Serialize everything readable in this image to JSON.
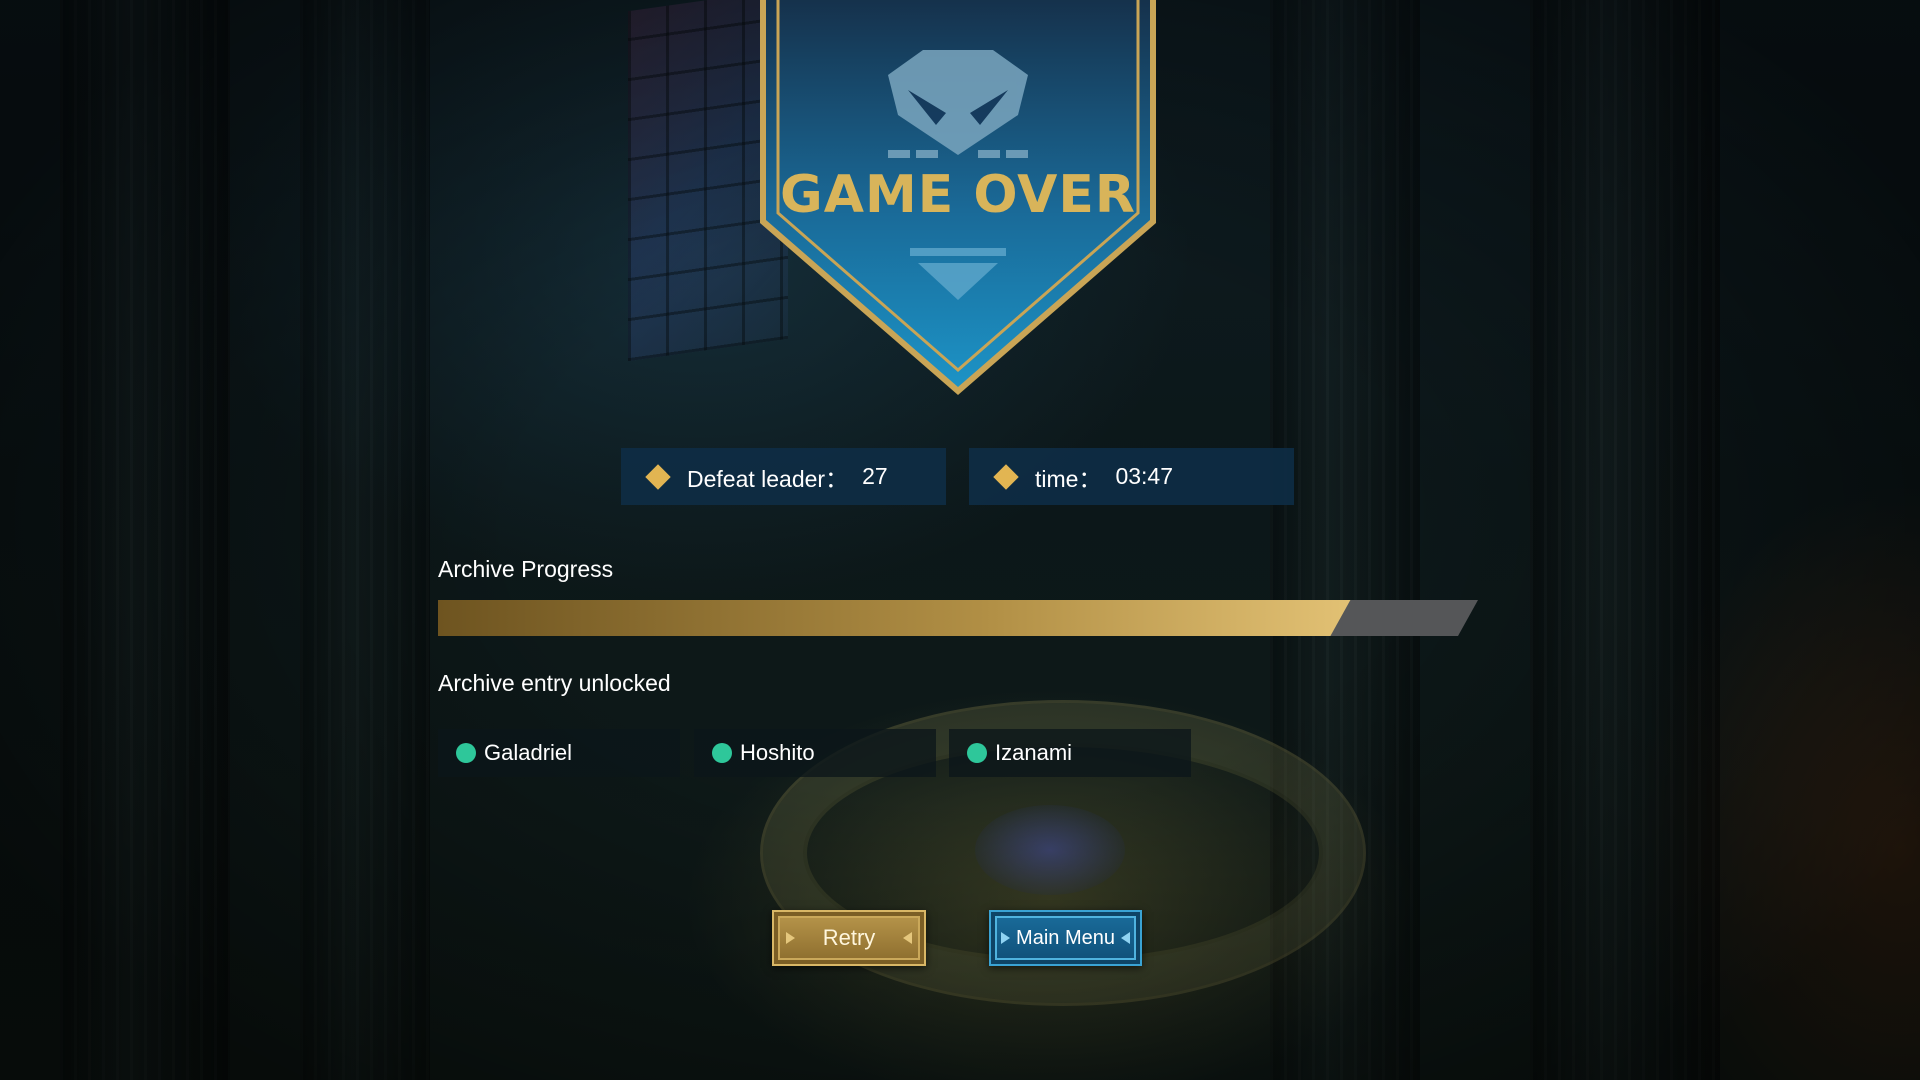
{
  "banner": {
    "title": "GAME OVER",
    "emblem_icon": "demon-mask-icon",
    "colors": {
      "gold": "#d8b45a",
      "banner_top": "#173a58",
      "banner_bottom": "#1a86b8"
    }
  },
  "stats": [
    {
      "label": "Defeat leader：",
      "value": "27",
      "icon": "diamond-icon"
    },
    {
      "label": "time：",
      "value": "03:47",
      "icon": "diamond-icon"
    }
  ],
  "archive": {
    "progress_label": "Archive Progress",
    "progress_fraction": 0.86,
    "unlocked_label": "Archive entry unlocked",
    "entries": [
      "Galadriel",
      "Hoshito",
      "Izanami"
    ],
    "entry_dot_color": "#2ec79a"
  },
  "buttons": {
    "retry": "Retry",
    "main_menu": "Main Menu"
  }
}
